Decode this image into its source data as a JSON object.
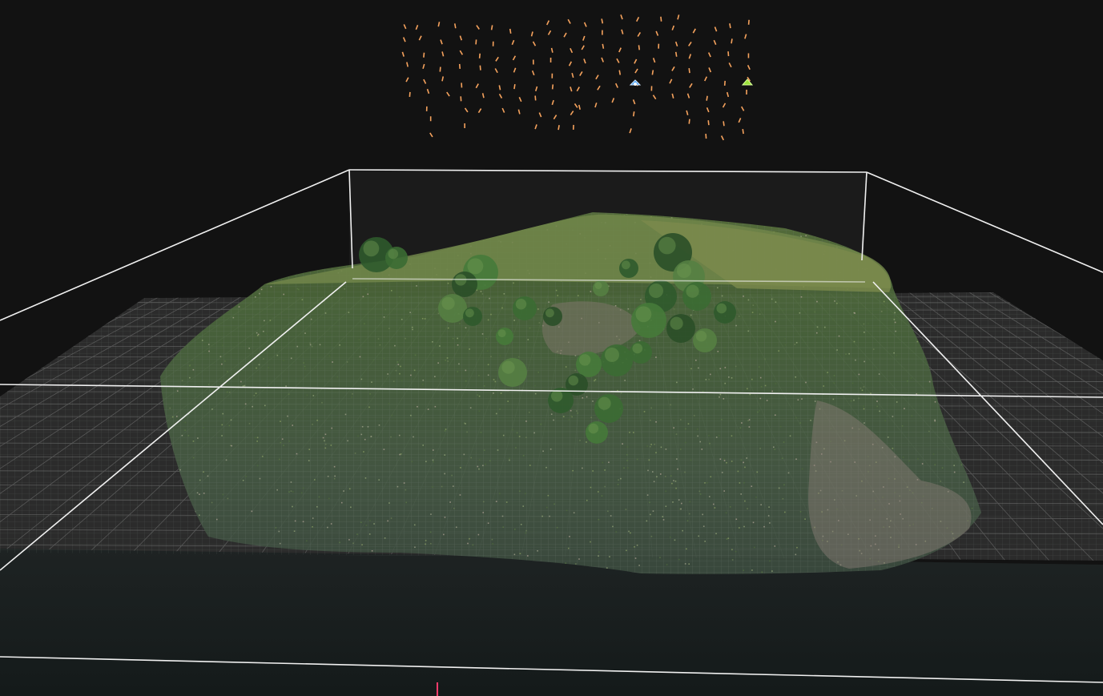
{
  "viewer": {
    "background_color": "#121212",
    "grid_color": "#8a8a8a",
    "bounding_box_color": "#f0f0f0",
    "camera_marker_color": "#f5a25d",
    "selected_camera_color": "#4aa3ff",
    "start_marker_color": "#9be33a",
    "origin_axis_color": "#ff3b6b"
  },
  "icons": {
    "camera_frustum": "camera-icon",
    "selected_camera": "camera-selected-icon",
    "start_position": "start-marker-icon"
  }
}
